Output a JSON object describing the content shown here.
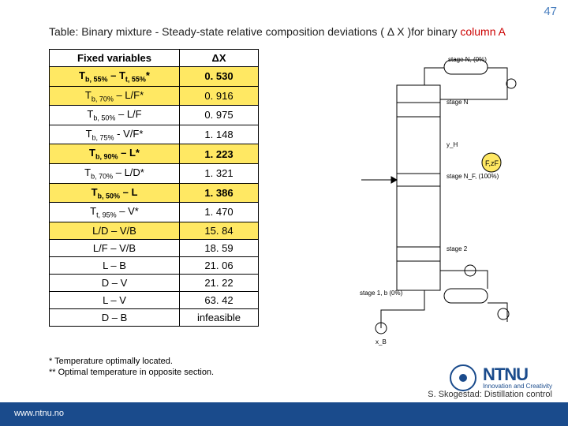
{
  "page_number": "47",
  "caption": {
    "pre": "Table: Binary mixture - Steady-state relative composition deviations (",
    "symbol": "Δ X",
    "post": ")for binary ",
    "hi": "column A"
  },
  "headers": {
    "c1": "Fixed variables",
    "c2": "ΔX"
  },
  "rows": [
    {
      "v1_html": "T<sub>b, 55%</sub> – T<sub>t, 55%</sub>*",
      "v2": "0. 530",
      "hi": true,
      "b": true
    },
    {
      "v1_html": "T<sub>b, 70%</sub> – L/F*",
      "v2": "0. 916",
      "hi": true,
      "b": false
    },
    {
      "v1_html": "T<sub>b, 50%</sub> – L/F",
      "v2": "0. 975",
      "hi": false,
      "b": false
    },
    {
      "v1_html": "T<sub>b, 75%</sub> - V/F*",
      "v2": "1. 148",
      "hi": false,
      "b": false
    },
    {
      "v1_html": "T<sub>b, 90%</sub> – L*",
      "v2": "1. 223",
      "hi": true,
      "b": true
    },
    {
      "v1_html": "T<sub>b, 70%</sub> – L/D*",
      "v2": "1. 321",
      "hi": false,
      "b": false
    },
    {
      "v1_html": "T<sub>b, 50%</sub> – L",
      "v2": "1. 386",
      "hi": true,
      "b": true
    },
    {
      "v1_html": "T<sub>t, 95%</sub> – V*",
      "v2": "1. 470",
      "hi": false,
      "b": false
    },
    {
      "v1_html": "L/D – V/B",
      "v2": "15. 84",
      "hi": true,
      "b": false
    },
    {
      "v1_html": "L/F – V/B",
      "v2": "18. 59",
      "hi": false,
      "b": false
    },
    {
      "v1_html": "L – B",
      "v2": "21. 06",
      "hi": false,
      "b": false
    },
    {
      "v1_html": "D – V",
      "v2": "21. 22",
      "hi": false,
      "b": false
    },
    {
      "v1_html": "L – V",
      "v2": "63. 42",
      "hi": false,
      "b": false
    },
    {
      "v1_html": "D – B",
      "v2": "infeasible",
      "hi": false,
      "b": false
    }
  ],
  "footnote": {
    "l1": "* Temperature optimally located.",
    "l2": "** Optimal temperature in opposite section."
  },
  "ntnu": {
    "label": "NTNU",
    "tagline": "Innovation and Creativity"
  },
  "footer_link": "www.ntnu.no",
  "credit": "S. Skogestad: Distillation control",
  "diagram_labels": {
    "top": "stage N, (0%)",
    "stageN": "stage N",
    "yH": "y_H",
    "stageNF": "stage N_F, (100%)",
    "stage2": "stage 2",
    "stage1b": "stage 1, b (0%)",
    "bot": "x_B"
  }
}
